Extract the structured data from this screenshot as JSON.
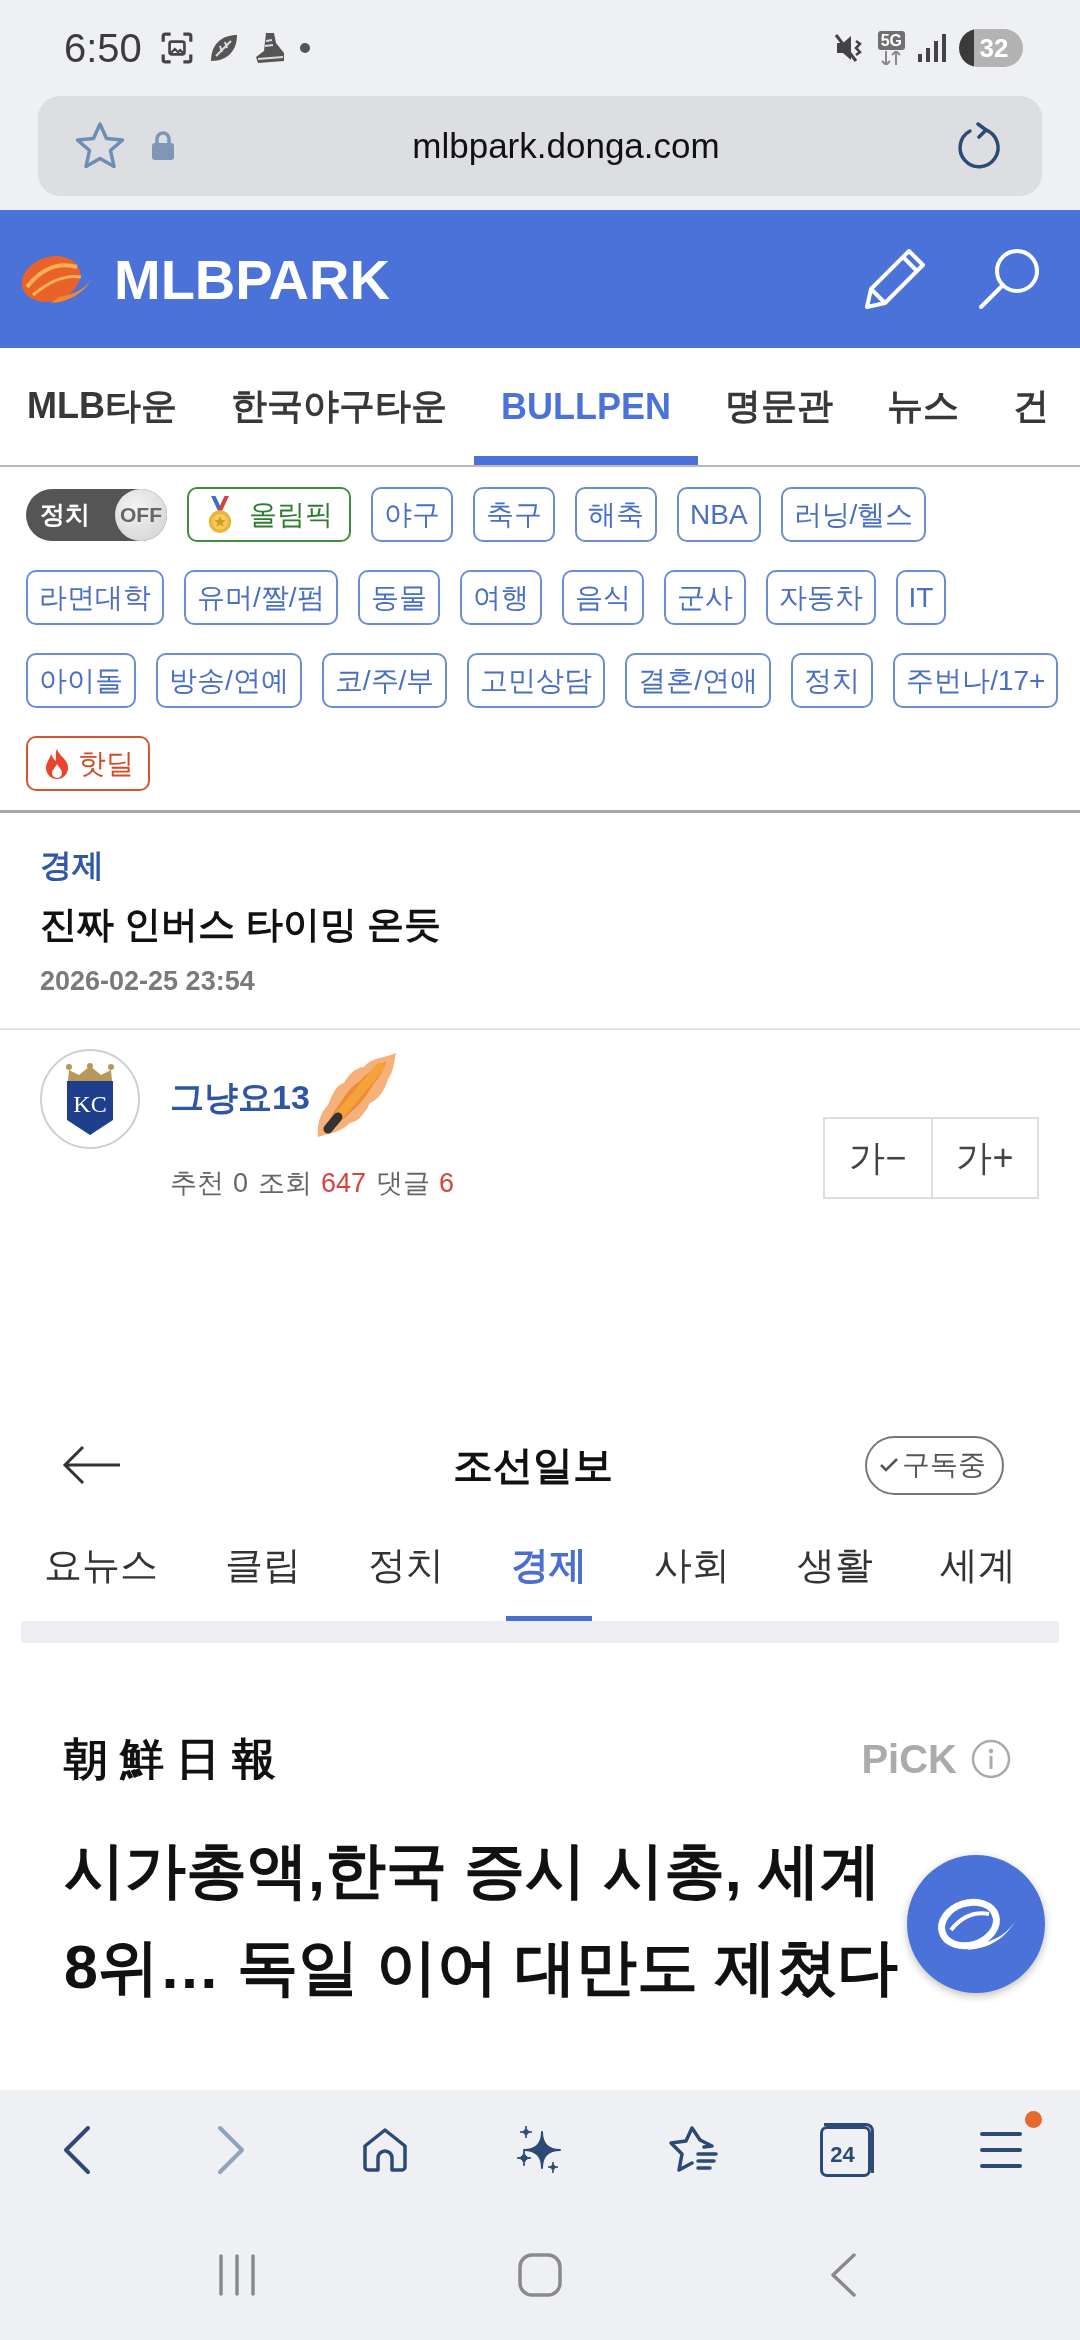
{
  "status_bar": {
    "time": "6:50",
    "network": "5G",
    "battery": "32"
  },
  "browser": {
    "url": "mlbpark.donga.com"
  },
  "site_header": {
    "logo_text": "MLBPARK"
  },
  "nav_tabs": [
    {
      "label": "MLB타운",
      "selected": false
    },
    {
      "label": "한국야구타운",
      "selected": false
    },
    {
      "label": "BULLPEN",
      "selected": true
    },
    {
      "label": "명문관",
      "selected": false
    },
    {
      "label": "뉴스",
      "selected": false
    },
    {
      "label": "건",
      "selected": false
    }
  ],
  "filter_toggle": {
    "label": "정치",
    "state_text": "OFF",
    "on": false
  },
  "tags": [
    {
      "label": "올림픽",
      "kind": "medal"
    },
    {
      "label": "야구",
      "kind": "plain"
    },
    {
      "label": "축구",
      "kind": "plain"
    },
    {
      "label": "해축",
      "kind": "plain"
    },
    {
      "label": "NBA",
      "kind": "plain"
    },
    {
      "label": "러닝/헬스",
      "kind": "plain"
    },
    {
      "label": "라면대학",
      "kind": "plain"
    },
    {
      "label": "유머/짤/펌",
      "kind": "plain"
    },
    {
      "label": "동물",
      "kind": "plain"
    },
    {
      "label": "여행",
      "kind": "plain"
    },
    {
      "label": "음식",
      "kind": "plain"
    },
    {
      "label": "군사",
      "kind": "plain"
    },
    {
      "label": "자동차",
      "kind": "plain"
    },
    {
      "label": "IT",
      "kind": "plain"
    },
    {
      "label": "아이돌",
      "kind": "plain"
    },
    {
      "label": "방송/연예",
      "kind": "plain"
    },
    {
      "label": "코/주/부",
      "kind": "plain"
    },
    {
      "label": "고민상담",
      "kind": "plain"
    },
    {
      "label": "결혼/연애",
      "kind": "plain"
    },
    {
      "label": "정치",
      "kind": "plain"
    },
    {
      "label": "주번나/17+",
      "kind": "plain"
    },
    {
      "label": "핫딜",
      "kind": "fire"
    }
  ],
  "article": {
    "category": "경제",
    "title": "진짜 인버스 타이밍 온듯",
    "date": "2026-02-25 23:54"
  },
  "author": {
    "avatar_monogram": "KC",
    "name": "그냥요13",
    "stats": [
      {
        "label": "추천",
        "value": "0",
        "highlight": false
      },
      {
        "label": "조회",
        "value": "647",
        "highlight": true
      },
      {
        "label": "댓글",
        "value": "6",
        "highlight": true
      }
    ]
  },
  "font_size_buttons": [
    "가−",
    "가+"
  ],
  "embedded_screenshot": {
    "title": "조선일보",
    "subscribe_label": "구독중",
    "tabs": [
      {
        "label": "요뉴스",
        "selected": false
      },
      {
        "label": "클립",
        "selected": false
      },
      {
        "label": "정치",
        "selected": false
      },
      {
        "label": "경제",
        "selected": true
      },
      {
        "label": "사회",
        "selected": false
      },
      {
        "label": "생활",
        "selected": false
      },
      {
        "label": "세계",
        "selected": false
      }
    ],
    "publisher_logo": "朝鮮日報",
    "pick_label": "PiCK",
    "headline": "시가총액,한국 증시 시총, 세계 8위… 독일 이어 대만도 제쳤다"
  },
  "bottom_toolbar": {
    "tabs_count": "24",
    "menu_badge": true
  }
}
